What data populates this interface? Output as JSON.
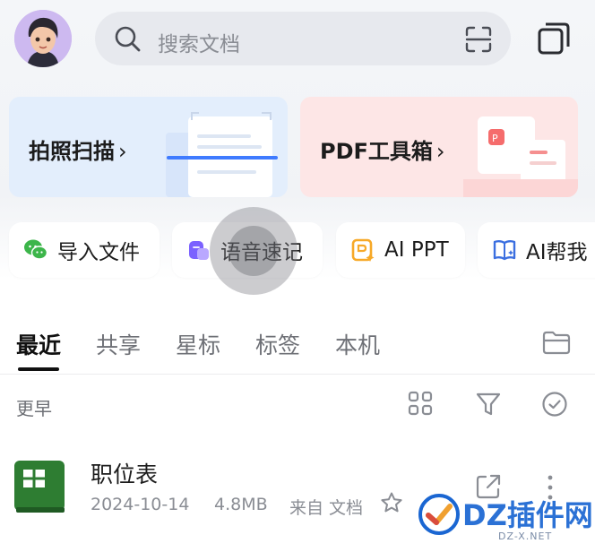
{
  "header": {
    "search_placeholder": "搜索文档"
  },
  "cards": [
    {
      "label": "拍照扫描",
      "chevron": "›",
      "accent": "#e3eefc"
    },
    {
      "label": "PDF工具箱",
      "chevron": "›",
      "accent": "#fde6e6"
    }
  ],
  "shortcuts": [
    {
      "label": "导入文件",
      "icon": "wechat-icon"
    },
    {
      "label": "语音速记",
      "icon": "voice-memo-icon"
    },
    {
      "label": "AI PPT",
      "icon": "ai-ppt-icon"
    },
    {
      "label": "AI帮我",
      "icon": "ai-book-icon"
    }
  ],
  "tabs": [
    "最近",
    "共享",
    "星标",
    "标签",
    "本机"
  ],
  "active_tab": "最近",
  "section": {
    "label": "更早"
  },
  "files": [
    {
      "name": "职位表",
      "date": "2024-10-14",
      "size": "4.8MB",
      "source": "来自 文档",
      "type_icon": "spreadsheet-icon",
      "starred": false
    }
  ],
  "watermark": {
    "text": "DZ插件网",
    "sub": "DZ-X.NET"
  },
  "colors": {
    "spreadsheet_green": "#2e7d32",
    "voice_purple": "#7b61ff",
    "ppt_orange": "#f7a928",
    "wechat_green": "#3cb54a",
    "ai_blue": "#3b6fe0"
  }
}
